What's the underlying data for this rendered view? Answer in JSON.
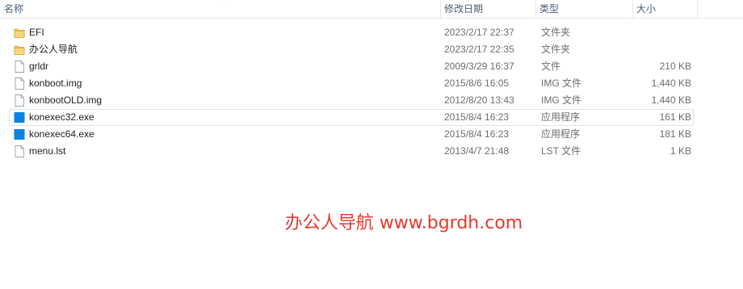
{
  "columns": {
    "name": "名称",
    "date": "修改日期",
    "type": "类型",
    "size": "大小"
  },
  "sort_indicator": "chevron-up-icon",
  "files": [
    {
      "name": "EFI",
      "date": "2023/2/17 22:37",
      "type": "文件夹",
      "size": "",
      "icon": "folder-icon",
      "selected": false
    },
    {
      "name": "办公人导航",
      "date": "2023/2/17 22:35",
      "type": "文件夹",
      "size": "",
      "icon": "folder-icon",
      "selected": false
    },
    {
      "name": "grldr",
      "date": "2009/3/29 16:37",
      "type": "文件",
      "size": "210 KB",
      "icon": "file-icon",
      "selected": false
    },
    {
      "name": "konboot.img",
      "date": "2015/8/6 16:05",
      "type": "IMG 文件",
      "size": "1,440 KB",
      "icon": "file-icon",
      "selected": false
    },
    {
      "name": "konbootOLD.img",
      "date": "2012/8/20 13:43",
      "type": "IMG 文件",
      "size": "1,440 KB",
      "icon": "file-icon",
      "selected": false
    },
    {
      "name": "konexec32.exe",
      "date": "2015/8/4 16:23",
      "type": "应用程序",
      "size": "161 KB",
      "icon": "application-icon",
      "selected": true
    },
    {
      "name": "konexec64.exe",
      "date": "2015/8/4 16:23",
      "type": "应用程序",
      "size": "181 KB",
      "icon": "application-icon",
      "selected": false
    },
    {
      "name": "menu.lst",
      "date": "2013/4/7 21:48",
      "type": "LST 文件",
      "size": "1 KB",
      "icon": "file-icon",
      "selected": false
    }
  ],
  "watermark": "办公人导航 www.bgrdh.com",
  "colors": {
    "folder": "#f2c55c",
    "application": "#0a84e0",
    "watermark": "#e8382e",
    "selection_border": "#d9e4f2"
  }
}
